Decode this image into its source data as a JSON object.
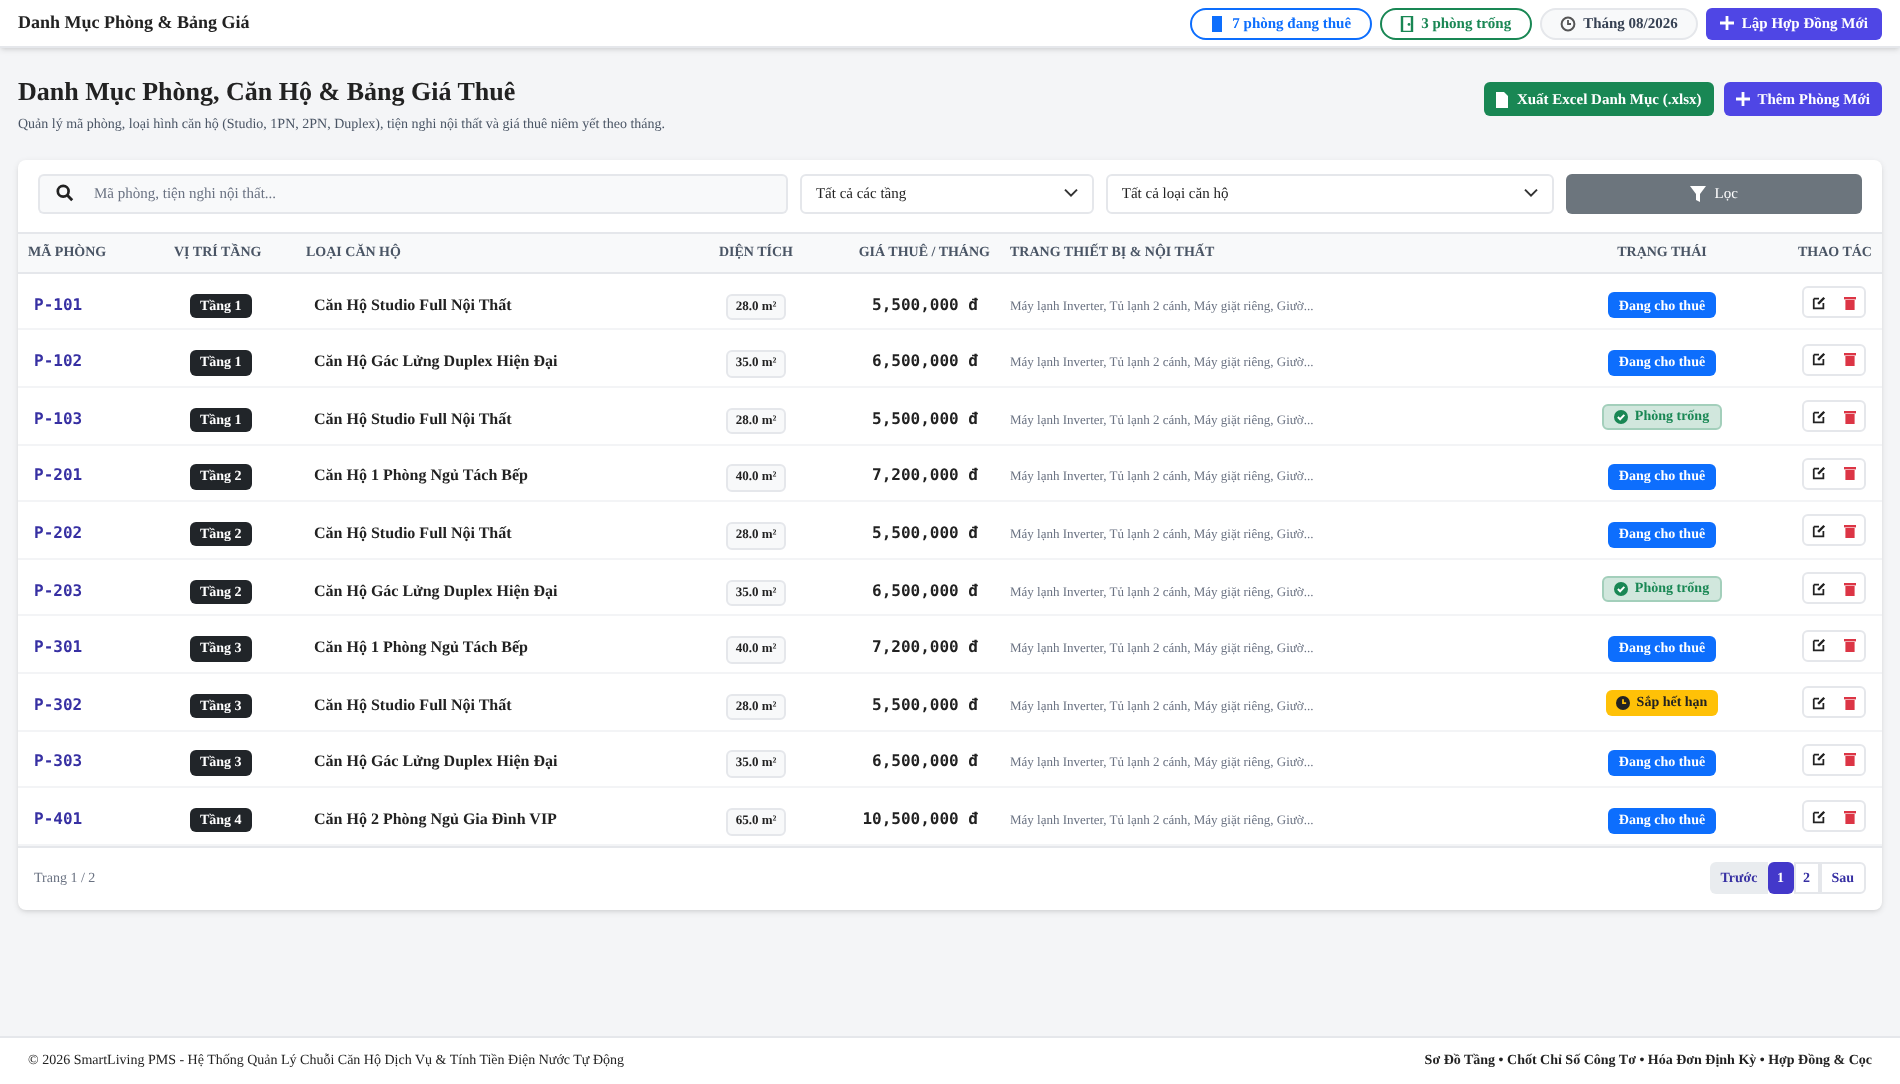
{
  "topbar": {
    "title": "Danh Mục Phòng & Bảng Giá",
    "pills": [
      {
        "kind": "rented",
        "label": "7 phòng đang thuê"
      },
      {
        "kind": "vacant",
        "label": "3 phòng trống"
      },
      {
        "kind": "date",
        "label": "Tháng 08/2026"
      }
    ],
    "primary_button": "Lập Hợp Đồng Mới"
  },
  "header": {
    "title": "Danh Mục Phòng, Căn Hộ & Bảng Giá Thuê",
    "subtitle": "Quản lý mã phòng, loại hình căn hộ (Studio, 1PN, 2PN, Duplex), tiện nghi nội thất và giá thuê niêm yết theo tháng.",
    "export_button": "Xuất Excel Danh Mục (.xlsx)",
    "add_button": "Thêm Phòng Mới"
  },
  "filters": {
    "search_placeholder": "Mã phòng, tiện nghi nội thất...",
    "floor_select": "Tất cả các tầng",
    "type_select": "Tất cả loại căn hộ",
    "filter_button": "Lọc"
  },
  "table": {
    "columns": [
      "MÃ PHÒNG",
      "VỊ TRÍ TẦNG",
      "LOẠI CĂN HỘ",
      "DIỆN TÍCH",
      "GIÁ THUÊ / THÁNG",
      "TRANG THIẾT BỊ & NỘI THẤT",
      "TRẠNG THÁI",
      "THAO TÁC"
    ],
    "rows": [
      {
        "code": "P-101",
        "floor": "Tầng 1",
        "type": "Căn Hộ Studio Full Nội Thất",
        "area": "28.0 m²",
        "price": "5,500,000 đ",
        "amenities": "Máy lạnh Inverter, Tủ lạnh 2 cánh, Máy giặt riêng, Giườ...",
        "status": {
          "kind": "rented",
          "label": "Đang cho thuê"
        }
      },
      {
        "code": "P-102",
        "floor": "Tầng 1",
        "type": "Căn Hộ Gác Lửng Duplex Hiện Đại",
        "area": "35.0 m²",
        "price": "6,500,000 đ",
        "amenities": "Máy lạnh Inverter, Tủ lạnh 2 cánh, Máy giặt riêng, Giườ...",
        "status": {
          "kind": "rented",
          "label": "Đang cho thuê"
        }
      },
      {
        "code": "P-103",
        "floor": "Tầng 1",
        "type": "Căn Hộ Studio Full Nội Thất",
        "area": "28.0 m²",
        "price": "5,500,000 đ",
        "amenities": "Máy lạnh Inverter, Tủ lạnh 2 cánh, Máy giặt riêng, Giườ...",
        "status": {
          "kind": "vacant",
          "label": "Phòng trống"
        }
      },
      {
        "code": "P-201",
        "floor": "Tầng 2",
        "type": "Căn Hộ 1 Phòng Ngủ Tách Bếp",
        "area": "40.0 m²",
        "price": "7,200,000 đ",
        "amenities": "Máy lạnh Inverter, Tủ lạnh 2 cánh, Máy giặt riêng, Giườ...",
        "status": {
          "kind": "rented",
          "label": "Đang cho thuê"
        }
      },
      {
        "code": "P-202",
        "floor": "Tầng 2",
        "type": "Căn Hộ Studio Full Nội Thất",
        "area": "28.0 m²",
        "price": "5,500,000 đ",
        "amenities": "Máy lạnh Inverter, Tủ lạnh 2 cánh, Máy giặt riêng, Giườ...",
        "status": {
          "kind": "rented",
          "label": "Đang cho thuê"
        }
      },
      {
        "code": "P-203",
        "floor": "Tầng 2",
        "type": "Căn Hộ Gác Lửng Duplex Hiện Đại",
        "area": "35.0 m²",
        "price": "6,500,000 đ",
        "amenities": "Máy lạnh Inverter, Tủ lạnh 2 cánh, Máy giặt riêng, Giườ...",
        "status": {
          "kind": "vacant",
          "label": "Phòng trống"
        }
      },
      {
        "code": "P-301",
        "floor": "Tầng 3",
        "type": "Căn Hộ 1 Phòng Ngủ Tách Bếp",
        "area": "40.0 m²",
        "price": "7,200,000 đ",
        "amenities": "Máy lạnh Inverter, Tủ lạnh 2 cánh, Máy giặt riêng, Giườ...",
        "status": {
          "kind": "rented",
          "label": "Đang cho thuê"
        }
      },
      {
        "code": "P-302",
        "floor": "Tầng 3",
        "type": "Căn Hộ Studio Full Nội Thất",
        "area": "28.0 m²",
        "price": "5,500,000 đ",
        "amenities": "Máy lạnh Inverter, Tủ lạnh 2 cánh, Máy giặt riêng, Giườ...",
        "status": {
          "kind": "expiring",
          "label": "Sắp hết hạn"
        }
      },
      {
        "code": "P-303",
        "floor": "Tầng 3",
        "type": "Căn Hộ Gác Lửng Duplex Hiện Đại",
        "area": "35.0 m²",
        "price": "6,500,000 đ",
        "amenities": "Máy lạnh Inverter, Tủ lạnh 2 cánh, Máy giặt riêng, Giườ...",
        "status": {
          "kind": "rented",
          "label": "Đang cho thuê"
        }
      },
      {
        "code": "P-401",
        "floor": "Tầng 4",
        "type": "Căn Hộ 2 Phòng Ngủ Gia Đình VIP",
        "area": "65.0 m²",
        "price": "10,500,000 đ",
        "amenities": "Máy lạnh Inverter, Tủ lạnh 2 cánh, Máy giặt riêng, Giườ...",
        "status": {
          "kind": "rented",
          "label": "Đang cho thuê"
        }
      }
    ]
  },
  "pagination": {
    "info": "Trang 1 / 2",
    "prev": "Trước",
    "pages": [
      {
        "label": "1",
        "selected": true
      },
      {
        "label": "2",
        "selected": false
      }
    ],
    "next": "Sau"
  },
  "footer": {
    "left": "© 2026 SmartLiving PMS - Hệ Thống Quản Lý Chuỗi Căn Hộ Dịch Vụ & Tính Tiền Điện Nước Tự Động",
    "right": "Sơ Đồ Tầng • Chốt Chỉ Số Công Tơ • Hóa Đơn Định Kỳ • Hợp Đồng & Cọc"
  }
}
